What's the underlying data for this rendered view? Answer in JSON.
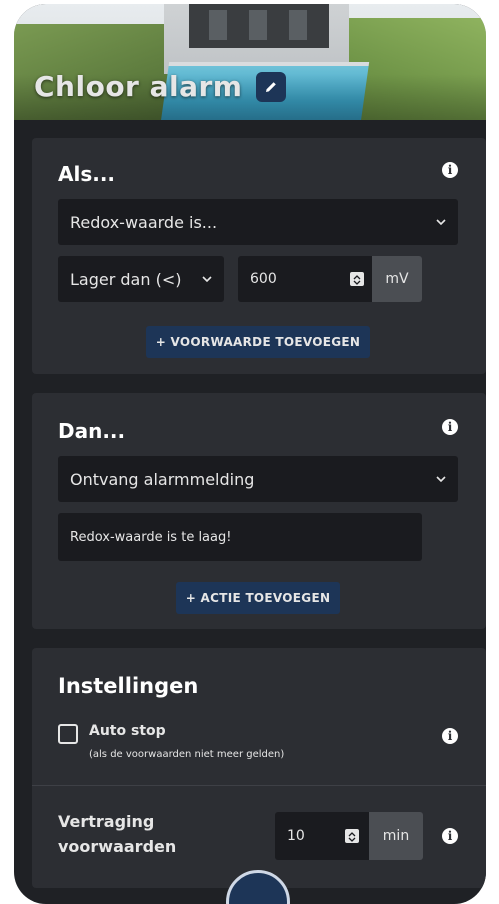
{
  "header": {
    "title": "Chloor alarm"
  },
  "if_section": {
    "title": "Als...",
    "condition_select": "Redox-waarde is...",
    "comparator_select": "Lager dan (<)",
    "value": "600",
    "unit": "mV",
    "add_button": "+ VOORWAARDE TOEVOEGEN"
  },
  "then_section": {
    "title": "Dan...",
    "action_select": "Ontvang alarmmelding",
    "message": "Redox-waarde is te laag!",
    "add_button": "+ ACTIE TOEVOEGEN"
  },
  "settings": {
    "title": "Instellingen",
    "auto_stop_label": "Auto stop",
    "auto_stop_hint": "(als de voorwaarden niet meer gelden)",
    "delay_label_line1": "Vertraging",
    "delay_label_line2": "voorwaarden",
    "delay_value": "10",
    "delay_unit": "min"
  }
}
